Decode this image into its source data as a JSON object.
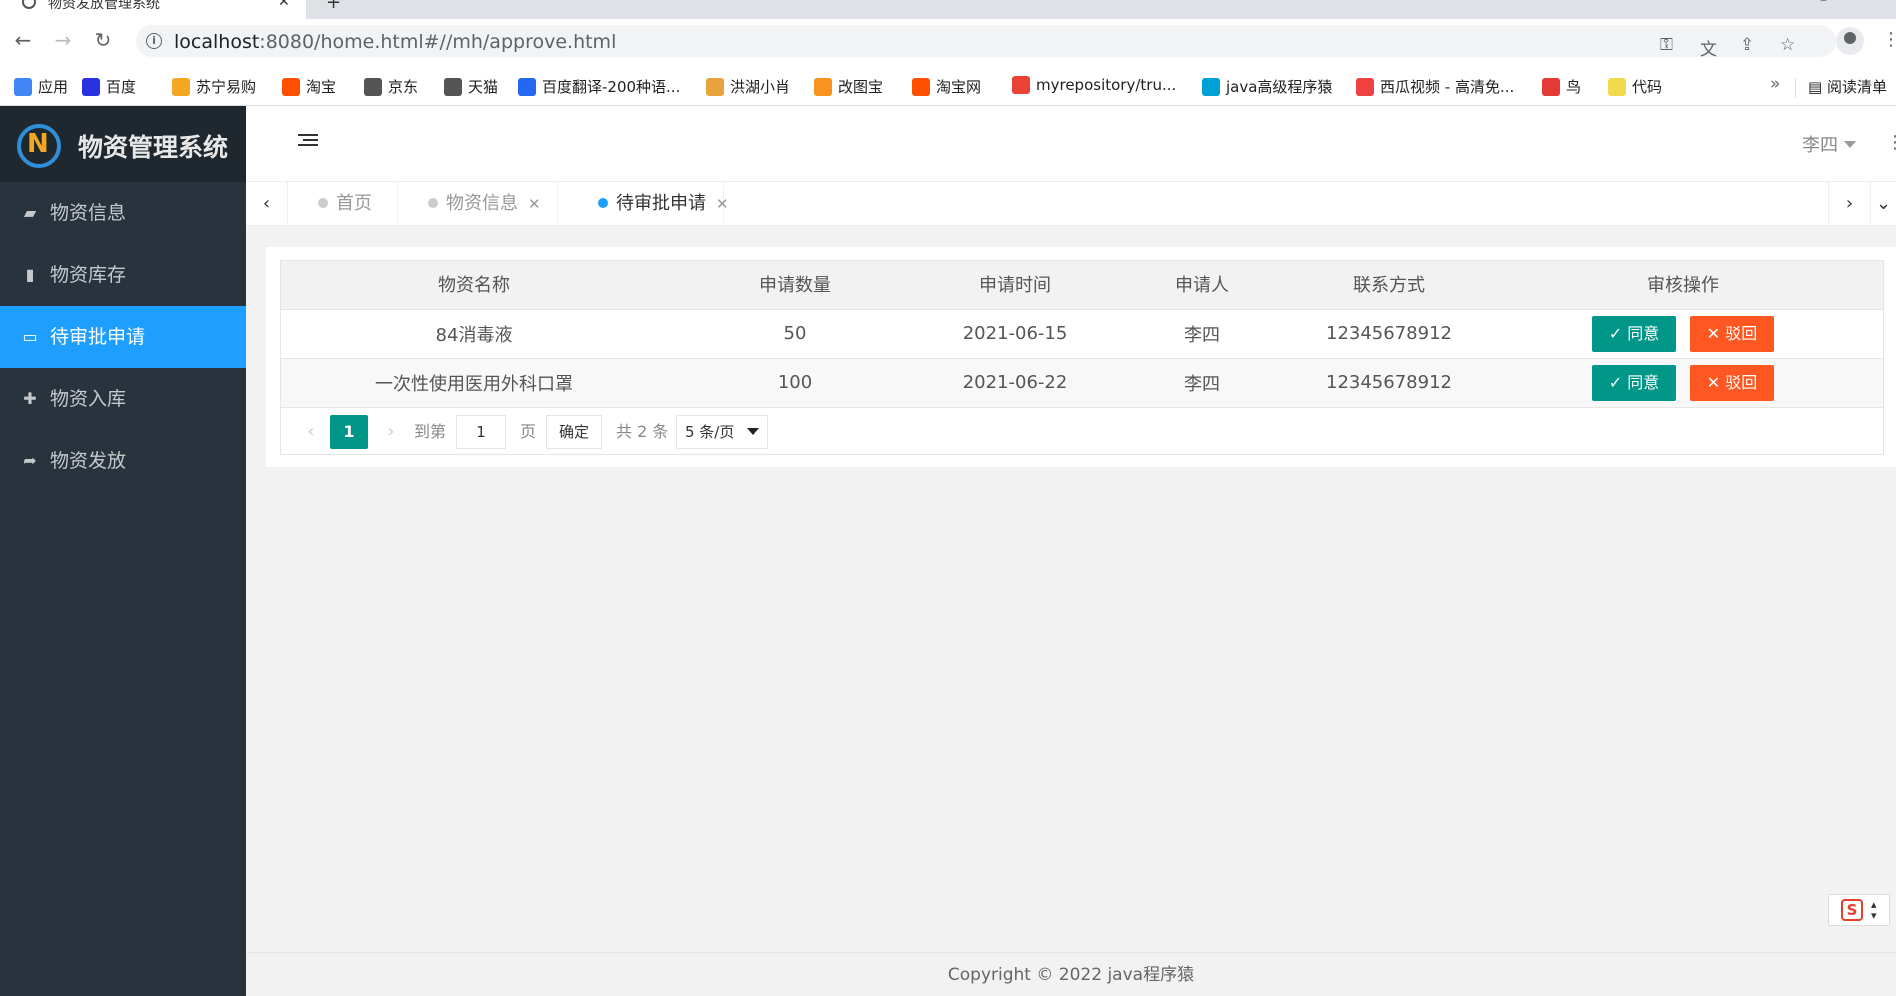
{
  "browser": {
    "tab_title": "物资发放管理系统",
    "url_host": "localhost",
    "url_rest": ":8080/home.html#//mh/approve.html",
    "bookmarks": [
      {
        "label": "应用",
        "color": "#4285f4"
      },
      {
        "label": "百度",
        "color": "#2932e1"
      },
      {
        "label": "苏宁易购",
        "color": "#f5a623"
      },
      {
        "label": "淘宝",
        "color": "#ff5000"
      },
      {
        "label": "京东",
        "color": "#555555"
      },
      {
        "label": "天猫",
        "color": "#555555"
      },
      {
        "label": "百度翻译-200种语...",
        "color": "#2468f2"
      },
      {
        "label": "洪湖小肖",
        "color": "#e8a33d"
      },
      {
        "label": "改图宝",
        "color": "#f7931e"
      },
      {
        "label": "淘宝网",
        "color": "#ff5000"
      },
      {
        "label": "myrepository/tru...",
        "color": "#ea4335"
      },
      {
        "label": "java高级程序猿",
        "color": "#00a1d6"
      },
      {
        "label": "西瓜视频 - 高清免...",
        "color": "#f04142"
      },
      {
        "label": "鸟",
        "color": "#e53935"
      },
      {
        "label": "代码",
        "color": "#f2d94e"
      }
    ],
    "reading_list": "阅读清单"
  },
  "app": {
    "title": "物资管理系统",
    "user": "李四",
    "menu": [
      {
        "label": "物资信息",
        "icon": "book-icon",
        "glyph": "▰"
      },
      {
        "label": "物资库存",
        "icon": "bar-chart-icon",
        "glyph": "▮"
      },
      {
        "label": "待审批申请",
        "icon": "laptop-icon",
        "glyph": "▭"
      },
      {
        "label": "物资入库",
        "icon": "plus-icon",
        "glyph": "✚"
      },
      {
        "label": "物资发放",
        "icon": "share-icon",
        "glyph": "➦"
      }
    ],
    "active_menu": 2,
    "tabs": [
      {
        "label": "首页"
      },
      {
        "label": "物资信息"
      },
      {
        "label": "待审批申请"
      }
    ]
  },
  "table": {
    "headers": [
      "物资名称",
      "申请数量",
      "申请时间",
      "申请人",
      "联系方式",
      "审核操作"
    ],
    "rows": [
      {
        "name": "84消毒液",
        "qty": "50",
        "date": "2021-06-15",
        "applicant": "李四",
        "phone": "12345678912"
      },
      {
        "name": "一次性使用医用外科口罩",
        "qty": "100",
        "date": "2021-06-22",
        "applicant": "李四",
        "phone": "12345678912"
      }
    ],
    "approve_label": "同意",
    "reject_label": "驳回"
  },
  "pager": {
    "current": "1",
    "goto_label": "到第",
    "goto_value": "1",
    "page_unit": "页",
    "confirm_label": "确定",
    "total_label": "共 2 条",
    "page_size": "5 条/页"
  },
  "footer": "Copyright © 2022 java程序猿"
}
